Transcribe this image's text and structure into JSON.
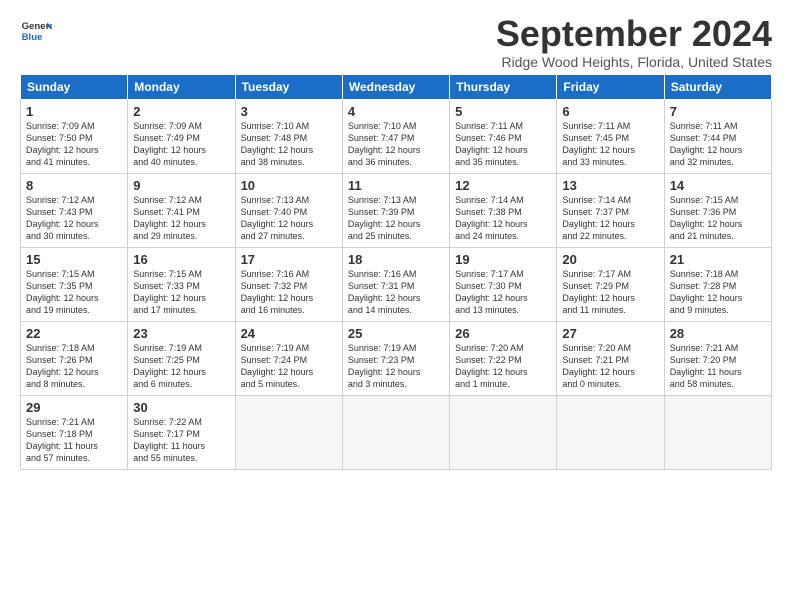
{
  "logo": {
    "line1": "General",
    "line2": "Blue"
  },
  "title": "September 2024",
  "subtitle": "Ridge Wood Heights, Florida, United States",
  "days_header": [
    "Sunday",
    "Monday",
    "Tuesday",
    "Wednesday",
    "Thursday",
    "Friday",
    "Saturday"
  ],
  "weeks": [
    [
      {
        "day": "1",
        "info": "Sunrise: 7:09 AM\nSunset: 7:50 PM\nDaylight: 12 hours\nand 41 minutes."
      },
      {
        "day": "2",
        "info": "Sunrise: 7:09 AM\nSunset: 7:49 PM\nDaylight: 12 hours\nand 40 minutes."
      },
      {
        "day": "3",
        "info": "Sunrise: 7:10 AM\nSunset: 7:48 PM\nDaylight: 12 hours\nand 38 minutes."
      },
      {
        "day": "4",
        "info": "Sunrise: 7:10 AM\nSunset: 7:47 PM\nDaylight: 12 hours\nand 36 minutes."
      },
      {
        "day": "5",
        "info": "Sunrise: 7:11 AM\nSunset: 7:46 PM\nDaylight: 12 hours\nand 35 minutes."
      },
      {
        "day": "6",
        "info": "Sunrise: 7:11 AM\nSunset: 7:45 PM\nDaylight: 12 hours\nand 33 minutes."
      },
      {
        "day": "7",
        "info": "Sunrise: 7:11 AM\nSunset: 7:44 PM\nDaylight: 12 hours\nand 32 minutes."
      }
    ],
    [
      {
        "day": "8",
        "info": "Sunrise: 7:12 AM\nSunset: 7:43 PM\nDaylight: 12 hours\nand 30 minutes."
      },
      {
        "day": "9",
        "info": "Sunrise: 7:12 AM\nSunset: 7:41 PM\nDaylight: 12 hours\nand 29 minutes."
      },
      {
        "day": "10",
        "info": "Sunrise: 7:13 AM\nSunset: 7:40 PM\nDaylight: 12 hours\nand 27 minutes."
      },
      {
        "day": "11",
        "info": "Sunrise: 7:13 AM\nSunset: 7:39 PM\nDaylight: 12 hours\nand 25 minutes."
      },
      {
        "day": "12",
        "info": "Sunrise: 7:14 AM\nSunset: 7:38 PM\nDaylight: 12 hours\nand 24 minutes."
      },
      {
        "day": "13",
        "info": "Sunrise: 7:14 AM\nSunset: 7:37 PM\nDaylight: 12 hours\nand 22 minutes."
      },
      {
        "day": "14",
        "info": "Sunrise: 7:15 AM\nSunset: 7:36 PM\nDaylight: 12 hours\nand 21 minutes."
      }
    ],
    [
      {
        "day": "15",
        "info": "Sunrise: 7:15 AM\nSunset: 7:35 PM\nDaylight: 12 hours\nand 19 minutes."
      },
      {
        "day": "16",
        "info": "Sunrise: 7:15 AM\nSunset: 7:33 PM\nDaylight: 12 hours\nand 17 minutes."
      },
      {
        "day": "17",
        "info": "Sunrise: 7:16 AM\nSunset: 7:32 PM\nDaylight: 12 hours\nand 16 minutes."
      },
      {
        "day": "18",
        "info": "Sunrise: 7:16 AM\nSunset: 7:31 PM\nDaylight: 12 hours\nand 14 minutes."
      },
      {
        "day": "19",
        "info": "Sunrise: 7:17 AM\nSunset: 7:30 PM\nDaylight: 12 hours\nand 13 minutes."
      },
      {
        "day": "20",
        "info": "Sunrise: 7:17 AM\nSunset: 7:29 PM\nDaylight: 12 hours\nand 11 minutes."
      },
      {
        "day": "21",
        "info": "Sunrise: 7:18 AM\nSunset: 7:28 PM\nDaylight: 12 hours\nand 9 minutes."
      }
    ],
    [
      {
        "day": "22",
        "info": "Sunrise: 7:18 AM\nSunset: 7:26 PM\nDaylight: 12 hours\nand 8 minutes."
      },
      {
        "day": "23",
        "info": "Sunrise: 7:19 AM\nSunset: 7:25 PM\nDaylight: 12 hours\nand 6 minutes."
      },
      {
        "day": "24",
        "info": "Sunrise: 7:19 AM\nSunset: 7:24 PM\nDaylight: 12 hours\nand 5 minutes."
      },
      {
        "day": "25",
        "info": "Sunrise: 7:19 AM\nSunset: 7:23 PM\nDaylight: 12 hours\nand 3 minutes."
      },
      {
        "day": "26",
        "info": "Sunrise: 7:20 AM\nSunset: 7:22 PM\nDaylight: 12 hours\nand 1 minute."
      },
      {
        "day": "27",
        "info": "Sunrise: 7:20 AM\nSunset: 7:21 PM\nDaylight: 12 hours\nand 0 minutes."
      },
      {
        "day": "28",
        "info": "Sunrise: 7:21 AM\nSunset: 7:20 PM\nDaylight: 11 hours\nand 58 minutes."
      }
    ],
    [
      {
        "day": "29",
        "info": "Sunrise: 7:21 AM\nSunset: 7:18 PM\nDaylight: 11 hours\nand 57 minutes."
      },
      {
        "day": "30",
        "info": "Sunrise: 7:22 AM\nSunset: 7:17 PM\nDaylight: 11 hours\nand 55 minutes."
      },
      {
        "day": "",
        "info": ""
      },
      {
        "day": "",
        "info": ""
      },
      {
        "day": "",
        "info": ""
      },
      {
        "day": "",
        "info": ""
      },
      {
        "day": "",
        "info": ""
      }
    ]
  ]
}
